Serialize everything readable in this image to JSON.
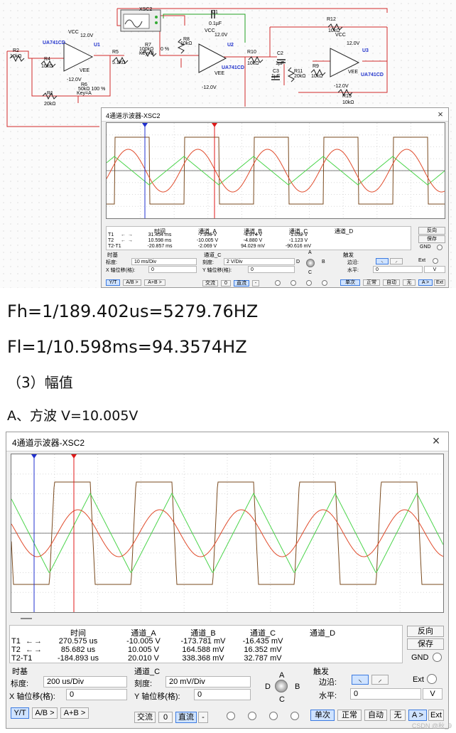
{
  "schematic": {
    "labels": {
      "xsc2": "XSC2",
      "c1": "C1",
      "c1_val": "0.1µF",
      "vcc1": "VCC",
      "v12_1": "12.0V",
      "u1_model": "UA741CD",
      "u1": "U1",
      "vee1": "VEE",
      "n12_1": "-12.0V",
      "r2": "R2",
      "r2v": "10kΩ",
      "r4": "R4",
      "r4v": "10kΩ",
      "r1": "R1",
      "r1v": "20kΩ",
      "r6": "R6",
      "r6v": "50kΩ 100 %",
      "r6k": "Key=A",
      "r5": "R5",
      "r5v": "5.1kΩ",
      "r7": "R7",
      "r7v": "100kΩ",
      "r7p": "0 %",
      "r7k": "Key=B",
      "r8": "R8",
      "r8v": "10kΩ",
      "vcc2": "VCC",
      "v12_2": "12.0V",
      "u2": "U2",
      "u2_model": "UA741CD",
      "vee2": "VEE",
      "n12_2": "-12.0V",
      "r10": "R10",
      "r10v": "10kΩ",
      "c2": "C2",
      "c2v": "1µF",
      "c3": "C3",
      "c3v": "1µF",
      "r11": "R11",
      "r11v": "20kΩ",
      "r9": "R9",
      "r9v": "10kΩ",
      "r12": "R12",
      "r12v": "10kΩ",
      "vcc3": "VCC",
      "v12_3": "12.0V",
      "u3": "U3",
      "u3_model": "UA741CD",
      "vee3": "VEE",
      "n12_3": "-12.0V",
      "r13": "R13",
      "r13v": "10kΩ"
    }
  },
  "scope1": {
    "title": "4通道示波器-XSC2",
    "close": "×",
    "headers": {
      "time": "时间",
      "a": "通道_A",
      "b": "通道_B",
      "c": "通道_C",
      "d": "通道_D"
    },
    "rows": [
      {
        "label": "T1",
        "time": "31.454 ms",
        "a": "-7.936 V",
        "b": "-4.974 V",
        "c": "-1.032 V"
      },
      {
        "label": "T2",
        "time": "10.598 ms",
        "a": "-10.005 V",
        "b": "-4.880 V",
        "c": "-1.123 V"
      },
      {
        "label": "T2-T1",
        "time": "-20.857 ms",
        "a": "-2.069 V",
        "b": "94.029 mV",
        "c": "-90.616 mV"
      }
    ],
    "reverse": "反向",
    "save": "保存",
    "gnd": "GND",
    "timebase": {
      "title": "时基",
      "scale_label": "标度:",
      "scale": "10 ms/Div",
      "xpos_label": "X 轴位移(格):",
      "xpos": "0"
    },
    "channel": {
      "title": "通道_C",
      "scale_label": "刻度:",
      "scale": "2  V/Div",
      "ypos_label": "Y 轴位移(格):",
      "ypos": "0"
    },
    "modes": [
      "Y/T",
      "A/B >",
      "A+B >"
    ],
    "coupling": [
      "交流",
      "0",
      "直流",
      "-"
    ],
    "knob": {
      "a": "A",
      "b": "B",
      "c": "C",
      "d": "D"
    },
    "trigger": {
      "title": "触发",
      "edge_label": "边沿:",
      "level_label": "水平:",
      "level": "0",
      "unit": "V",
      "ext": "Ext",
      "buttons": [
        "单次",
        "正常",
        "自动",
        "无",
        "A >",
        "Ext"
      ]
    }
  },
  "text": {
    "fh": "Fh=1/189.402us=5279.76HZ",
    "fl": "Fl=1/10.598ms=94.3574HZ",
    "section": "（3）幅值",
    "square": "A、方波  V=10.005V"
  },
  "scope2": {
    "title": "4通道示波器-XSC2",
    "close": "×",
    "headers": {
      "time": "时间",
      "a": "通道_A",
      "b": "通道_B",
      "c": "通道_C",
      "d": "通道_D"
    },
    "rows": [
      {
        "label": "T1",
        "time": "270.575 us",
        "a": "-10.005 V",
        "b": "-173.781 mV",
        "c": "-16.435 mV"
      },
      {
        "label": "T2",
        "time": "85.682 us",
        "a": "10.005 V",
        "b": "164.588 mV",
        "c": "16.352 mV"
      },
      {
        "label": "T2-T1",
        "time": "-184.893 us",
        "a": "20.010 V",
        "b": "338.368 mV",
        "c": "32.787 mV"
      }
    ],
    "reverse": "反向",
    "save": "保存",
    "gnd": "GND",
    "timebase": {
      "title": "时基",
      "scale_label": "标度:",
      "scale": "200 us/Div",
      "xpos_label": "X 轴位移(格):",
      "xpos": "0"
    },
    "channel": {
      "title": "通道_C",
      "scale_label": "刻度:",
      "scale": "20 mV/Div",
      "ypos_label": "Y 轴位移(格):",
      "ypos": "0"
    },
    "modes": [
      "Y/T",
      "A/B >",
      "A+B >"
    ],
    "coupling": [
      "交流",
      "0",
      "直流",
      "-"
    ],
    "knob": {
      "a": "A",
      "b": "B",
      "c": "C",
      "d": "D"
    },
    "trigger": {
      "title": "触发",
      "edge_label": "边沿:",
      "level_label": "水平:",
      "level": "0",
      "unit": "V",
      "ext": "Ext",
      "buttons": [
        "单次",
        "正常",
        "自动",
        "无",
        "A >",
        "Ext"
      ]
    }
  },
  "watermark": "CSDN @秋_9",
  "colors": {
    "channel_a": "#7a4a1e",
    "channel_b": "#e04a2a",
    "channel_c": "#4ad44a",
    "cursor_1": "#2030d0",
    "cursor_2": "#e01818",
    "wire": "#d22b2b",
    "wire_green": "#23a023"
  }
}
